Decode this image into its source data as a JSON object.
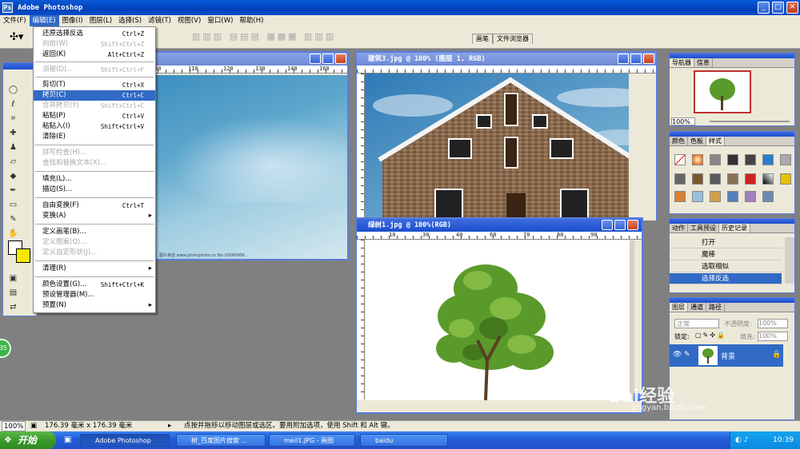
{
  "app": {
    "title": "Adobe Photoshop"
  },
  "menubar": [
    "文件(F)",
    "编辑(E)",
    "图像(I)",
    "图层(L)",
    "选择(S)",
    "滤镜(T)",
    "视图(V)",
    "窗口(W)",
    "帮助(H)"
  ],
  "top_tabs": [
    "画笔",
    "文件浏览器"
  ],
  "edit_menu": [
    {
      "label": "还原选择反选",
      "shortcut": "Ctrl+Z",
      "state": "normal"
    },
    {
      "label": "向前(W)",
      "shortcut": "Shift+Ctrl+Z",
      "state": "disabled"
    },
    {
      "label": "返回(K)",
      "shortcut": "Alt+Ctrl+Z",
      "state": "normal"
    },
    {
      "label": "消褪(D)...",
      "shortcut": "Shift+Ctrl+F",
      "state": "disabled"
    },
    {
      "label": "剪切(T)",
      "shortcut": "Ctrl+X",
      "state": "normal"
    },
    {
      "label": "拷贝(C)",
      "shortcut": "Ctrl+C",
      "state": "highlighted"
    },
    {
      "label": "合并拷贝(Y)",
      "shortcut": "Shift+Ctrl+C",
      "state": "disabled"
    },
    {
      "label": "粘贴(P)",
      "shortcut": "Ctrl+V",
      "state": "normal"
    },
    {
      "label": "粘贴入(I)",
      "shortcut": "Shift+Ctrl+V",
      "state": "normal"
    },
    {
      "label": "清除(E)",
      "shortcut": "",
      "state": "normal"
    },
    {
      "label": "拼写检查(H)...",
      "shortcut": "",
      "state": "disabled"
    },
    {
      "label": "查找和替换文本(X)...",
      "shortcut": "",
      "state": "disabled"
    },
    {
      "label": "填充(L)...",
      "shortcut": "",
      "state": "normal"
    },
    {
      "label": "描边(S)...",
      "shortcut": "",
      "state": "normal"
    },
    {
      "label": "自由变换(F)",
      "shortcut": "Ctrl+T",
      "state": "normal"
    },
    {
      "label": "变换(A)",
      "shortcut": "",
      "state": "submenu"
    },
    {
      "label": "定义画笔(B)...",
      "shortcut": "",
      "state": "normal"
    },
    {
      "label": "定义图案(Q)...",
      "shortcut": "",
      "state": "disabled"
    },
    {
      "label": "定义自定形状(J)...",
      "shortcut": "",
      "state": "disabled"
    },
    {
      "label": "清理(R)",
      "shortcut": "",
      "state": "submenu"
    },
    {
      "label": "颜色设置(G)...",
      "shortcut": "Shift+Ctrl+K",
      "state": "normal"
    },
    {
      "label": "预设管理器(M)...",
      "shortcut": "",
      "state": "normal"
    },
    {
      "label": "预置(N)",
      "shortcut": "",
      "state": "submenu"
    }
  ],
  "documents": {
    "building": {
      "title": "建筑3.jpg @ 100% (图层 1, RGB)"
    },
    "tree": {
      "title": "绿树1.jpg @ 100%(RGB)"
    },
    "ruler_ticks": [
      "10",
      "20",
      "30",
      "40",
      "50",
      "60",
      "70",
      "80",
      "90",
      "100",
      "110",
      "120",
      "130",
      "140",
      "150",
      "160"
    ],
    "sky_caption": "图片来自 www.photophoto.cn  No.20090908..."
  },
  "navigator": {
    "tabs": [
      "导航器",
      "信息"
    ],
    "zoom": "100%"
  },
  "swatches": {
    "tabs": [
      "颜色",
      "色板",
      "样式"
    ]
  },
  "history": {
    "tabs": [
      "动作",
      "工具预设",
      "历史记录"
    ],
    "items": [
      {
        "label": "打开",
        "selected": false
      },
      {
        "label": "魔棒",
        "selected": false
      },
      {
        "label": "选取相似",
        "selected": false
      },
      {
        "label": "选择反选",
        "selected": true
      }
    ]
  },
  "layers": {
    "tabs": [
      "图层",
      "通道",
      "路径"
    ],
    "blend_mode": "正常",
    "opacity_label": "不透明度:",
    "opacity": "100%",
    "lock_label": "锁定:",
    "fill_label": "填充:",
    "fill": "100%",
    "layer_name": "背景"
  },
  "status": {
    "zoom": "100%",
    "doc_size": "176.39 毫米 x 176.39 毫米",
    "hint": "点按并拖移以移动图层或选区。要用附加选项，使用 Shift 和 Alt 键。"
  },
  "taskbar": {
    "start": "开始",
    "tasks": [
      "Adobe Photoshop",
      "树_百度图片搜索 ...",
      "meil1.JPG - 画图",
      "baidu"
    ],
    "clock": "10:39"
  },
  "watermark": {
    "brand": "Bai经验",
    "url": "jingyan.baidu.com"
  },
  "badge": "35",
  "colors": {
    "accent": "#316ac5",
    "title_blue": "#0a4fcc",
    "taskbar": "#245ed8"
  }
}
